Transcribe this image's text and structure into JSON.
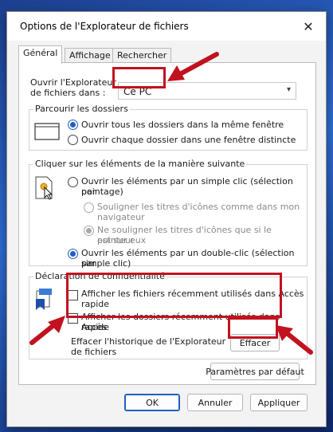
{
  "window": {
    "title": "Options de l'Explorateur de fichiers"
  },
  "tabs": [
    {
      "label": "Général",
      "active": true
    },
    {
      "label": "Affichage",
      "active": false
    },
    {
      "label": "Rechercher",
      "active": false
    }
  ],
  "open_in": {
    "label_line1": "Ouvrir l'Explorateur",
    "label_line2": "de fichiers dans :",
    "value": "Ce PC"
  },
  "browse": {
    "title": "Parcourir les dossiers",
    "options": [
      {
        "label": "Ouvrir tous les dossiers dans la même fenêtre",
        "checked": true
      },
      {
        "label": "Ouvrir chaque dossier dans une fenêtre distincte",
        "checked": false
      }
    ]
  },
  "click": {
    "title": "Cliquer sur les éléments de la manière suivante",
    "single_line1": "Ouvrir les éléments par un simple clic (sélection par",
    "single_line2": "pointage)",
    "underline_always_line1": "Souligner les titres d'icônes comme dans mon",
    "underline_always_line2": "navigateur",
    "underline_hover_line1": "Ne souligner les titres d'icônes que si le pointeur",
    "underline_hover_line2": "est sur eux",
    "double_line1": "Ouvrir les éléments par un double-clic (sélection par",
    "double_line2": "simple clic)"
  },
  "privacy": {
    "title": "Déclaration de confidentialité",
    "recent_files_line1": "Afficher les fichiers récemment utilisés dans Accès",
    "recent_files_line2": "rapide",
    "recent_folders_line1": "Afficher les dossiers récemment utilisés dans Accès",
    "recent_folders_line2": "rapide",
    "clear_line1": "Effacer l'historique de l'Explorateur",
    "clear_line2": "de fichiers",
    "clear_button": "Effacer"
  },
  "defaults_button": "Paramètres par défaut",
  "footer": {
    "ok": "OK",
    "cancel": "Annuler",
    "apply": "Appliquer"
  },
  "colors": {
    "annotation_red": "#c1121f",
    "accent": "#1f5fbf"
  },
  "icons": [
    "close-icon",
    "chevron-down-icon",
    "folder-window-icon",
    "pointer-click-icon",
    "privacy-icon",
    "annotation-arrow"
  ]
}
